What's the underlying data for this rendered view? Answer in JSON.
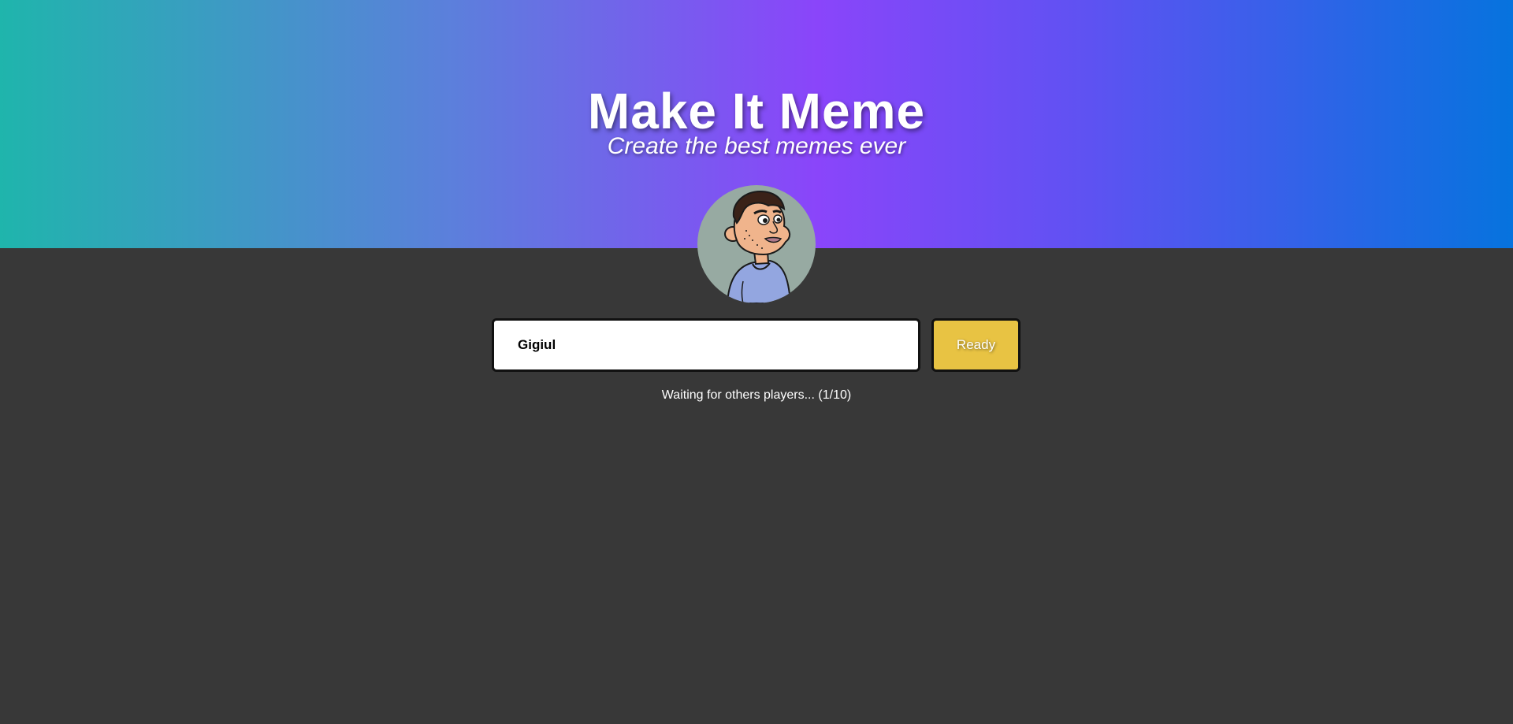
{
  "header": {
    "title": "Make It Meme",
    "subtitle": "Create the best memes ever"
  },
  "player": {
    "avatar_icon": "cartoon-man-avatar",
    "name_value": "Gigiul",
    "ready_label": "Ready"
  },
  "status": {
    "text": "Waiting for others players... (1/10)"
  },
  "colors": {
    "background": "#383838",
    "gradient_start": "#1fb5ac",
    "gradient_mid": "#8a45fa",
    "gradient_end": "#0673de",
    "ready_button": "#e8c343",
    "avatar_bg": "#97aaa2"
  }
}
